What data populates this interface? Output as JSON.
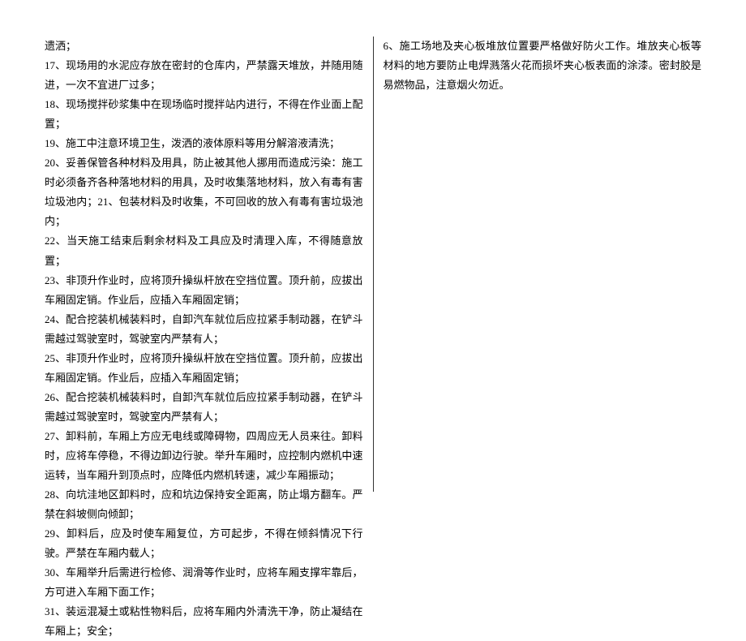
{
  "left_items": [
    "遗洒；",
    "17、现场用的水泥应存放在密封的仓库内，严禁露天堆放，并随用随进，一次不宜进厂过多；",
    "18、现场搅拌砂浆集中在现场临时搅拌站内进行，不得在作业面上配置；",
    "19、施工中注意环境卫生，泼洒的液体原料等用分解溶液清洗；",
    "20、妥善保管各种材料及用具，防止被其他人挪用而造成污染：施工时必须备齐各种落地材料的用具，及时收集落地材料，放入有毒有害垃圾池内；21、包装材料及时收集，不可回收的放入有毒有害垃圾池内；",
    "22、当天施工结束后剩余材料及工具应及时清理入库，不得随意放置；",
    "23、非顶升作业时，应将顶升操纵杆放在空挡位置。顶升前，应拔出车厢固定销。作业后，应插入车厢固定销；",
    "24、配合挖装机械装料时，自卸汽车就位后应拉紧手制动器，在铲斗需越过驾驶室时，驾驶室内严禁有人；",
    "25、非顶升作业时，应将顶升操纵杆放在空挡位置。顶升前，应拔出车厢固定销。作业后，应插入车厢固定销；",
    "26、配合挖装机械装料时，自卸汽车就位后应拉紧手制动器，在铲斗需越过驾驶室时，驾驶室内严禁有人；",
    "27、卸料前，车厢上方应无电线或障碍物，四周应无人员来往。卸料时，应将车停稳，不得边卸边行驶。举升车厢时，应控制内燃机中速运转，当车厢升到顶点时，应降低内燃机转速，减少车厢振动；",
    "28、向坑洼地区卸料时，应和坑边保持安全距离，防止塌方翻车。严禁在斜坡侧向倾卸；",
    "29、卸料后，应及时使车厢复位，方可起步，不得在倾斜情况下行驶。严禁在车厢内载人；",
    "30、车厢举升后需进行检修、润滑等作业时，应将车厢支撑牢靠后，方可进入车厢下面工作；",
    "31、装运混凝土或粘性物料后，应将车厢内外清洗干净，防止凝结在车厢上；安全；"
  ],
  "right_items": [
    "6、施工场地及夹心板堆放位置要严格做好防火工作。堆放夹心板等材料的地方要防止电焊溅落火花而损坏夹心板表面的涂漆。密封胶是易燃物品，注意烟火勿近。"
  ]
}
